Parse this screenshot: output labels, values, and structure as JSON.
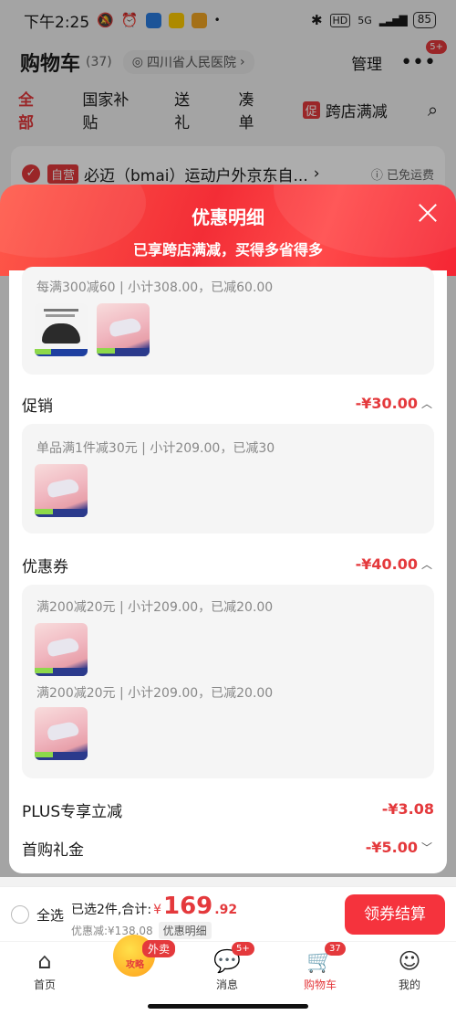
{
  "status": {
    "time": "下午2:25",
    "battery": "85",
    "net": "5G"
  },
  "header": {
    "title": "购物车",
    "count": "(37)",
    "location": "四川省人民医院",
    "manage": "管理",
    "more_badge": "5+"
  },
  "tabs": [
    "全部",
    "国家补贴",
    "送礼",
    "凑单",
    "跨店满减"
  ],
  "promo_tag": "促",
  "shop": {
    "tag": "自营",
    "name": "必迈（bmai）运动户外京东自...",
    "chevron": "›",
    "ship": "已免运费"
  },
  "sheet": {
    "title": "优惠明细",
    "subtitle": "已享跨店满减，买得多省得多",
    "cross_store_rule": "每满300减60 | 小计308.00，已减60.00",
    "promo": {
      "label": "促销",
      "amount": "-¥30.00",
      "rule": "单品满1件减30元 | 小计209.00，已减30"
    },
    "coupon": {
      "label": "优惠券",
      "amount": "-¥40.00",
      "rules": [
        "满200减20元 | 小计209.00，已减20.00",
        "满200减20元 | 小计209.00，已减20.00"
      ]
    },
    "plus": {
      "label": "PLUS专享立减",
      "amount": "-¥3.08"
    },
    "first": {
      "label": "首购礼金",
      "amount": "-¥5.00"
    }
  },
  "checkout": {
    "select_all": "全选",
    "selected": "已选2件,合计:",
    "currency": "¥",
    "price_int": "169",
    "price_dec": ".92",
    "saved": "优惠减:¥138.08",
    "detail": "优惠明细",
    "pay": "领券结算"
  },
  "tabbar": {
    "home": "首页",
    "waimai": "外卖",
    "center": "攻略",
    "messages": "消息",
    "messages_badge": "5+",
    "cart": "购物车",
    "cart_badge": "37",
    "mine": "我的"
  }
}
